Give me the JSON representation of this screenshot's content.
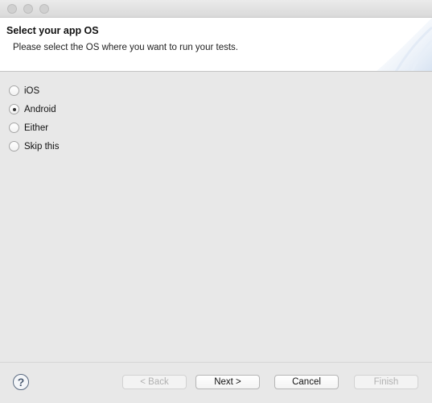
{
  "window": {
    "controls": [
      "close",
      "minimize",
      "maximize"
    ]
  },
  "header": {
    "title": "Select your app OS",
    "description": "Please select the OS where you want to run your tests."
  },
  "options": [
    {
      "label": "iOS",
      "checked": false
    },
    {
      "label": "Android",
      "checked": true
    },
    {
      "label": "Either",
      "checked": false
    },
    {
      "label": "Skip this",
      "checked": false
    }
  ],
  "footer": {
    "help_icon": "question-mark-icon",
    "help_glyph": "?",
    "back_label": "< Back",
    "next_label": "Next >",
    "cancel_label": "Cancel",
    "finish_label": "Finish"
  }
}
